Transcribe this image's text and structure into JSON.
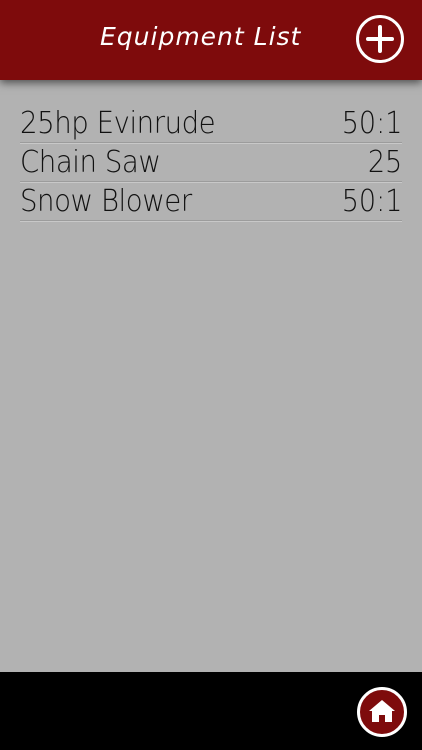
{
  "header": {
    "title": "Equipment List",
    "add_icon": "plus-circle-icon"
  },
  "equipment": [
    {
      "name": "25hp Evinrude",
      "ratio": "50:1"
    },
    {
      "name": "Chain Saw",
      "ratio": "25"
    },
    {
      "name": "Snow Blower",
      "ratio": "50:1"
    }
  ],
  "footer": {
    "home_icon": "home-icon"
  },
  "colors": {
    "header_bg": "#7e0b0c",
    "content_bg": "#b2b2b2",
    "footer_bg": "#000000",
    "text": "#111111",
    "accent_white": "#ffffff"
  }
}
